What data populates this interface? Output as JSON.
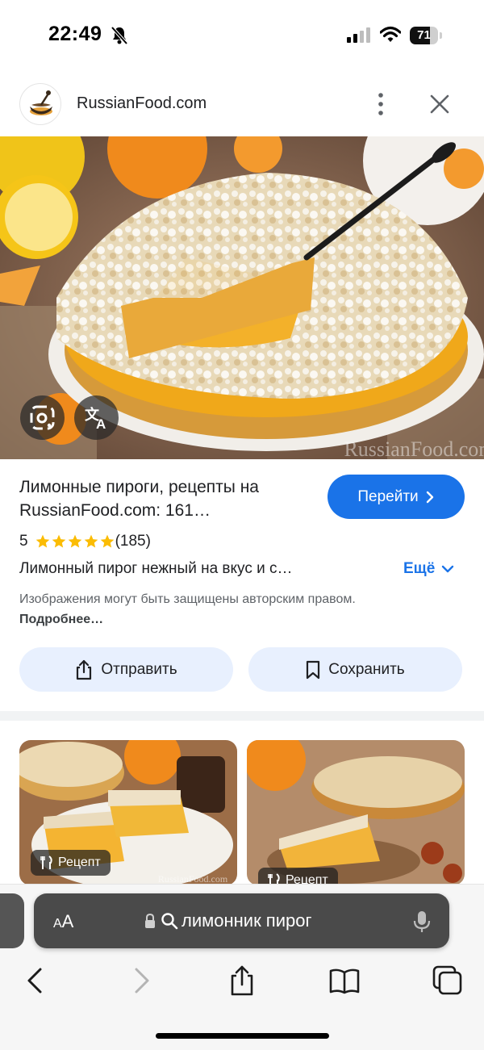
{
  "status_bar": {
    "time": "22:49",
    "battery": "71",
    "battery_level": 0.71
  },
  "header": {
    "site_name": "RussianFood.com",
    "more_icon": "more-vert-icon",
    "close_icon": "close-icon"
  },
  "image": {
    "watermark": "RussianFood.com",
    "lens_icon": "google-lens-icon",
    "translate_icon": "translate-icon"
  },
  "result": {
    "title": "Лимонные пироги, рецепты на RussianFood.com: 161…",
    "go_button": "Перейти",
    "rating_value": "5",
    "stars": 5,
    "rating_count": "(185)",
    "description": "Лимонный пирог нежный на вкус и с…",
    "more_label": "Ещё",
    "copyright_text": "Изображения могут быть защищены авторским правом.",
    "copyright_link": "Подробнее…",
    "share_button": "Отправить",
    "save_button": "Сохранить"
  },
  "related": [
    {
      "badge": "Рецепт",
      "watermark": "RussianFood.com"
    },
    {
      "badge": "Рецепт"
    }
  ],
  "browser": {
    "aa_label": "AA",
    "search_query": "лимонник пирог",
    "nav": [
      "back-icon",
      "forward-icon",
      "share-icon",
      "bookmarks-icon",
      "tabs-icon"
    ]
  },
  "colors": {
    "accent": "#1a73e8",
    "star": "#fbbc04",
    "pill_bg": "#e8f0fe"
  }
}
